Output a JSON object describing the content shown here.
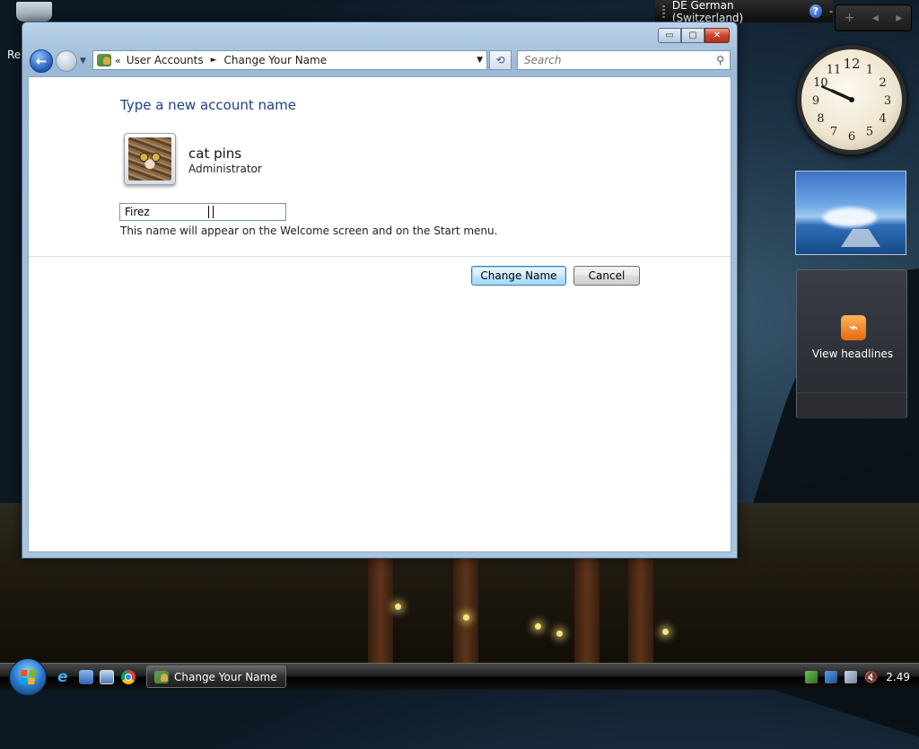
{
  "desktop": {
    "left_stub_text": "Re",
    "language_bar": {
      "language": "DE German (Switzerland)",
      "help": "?",
      "minimize": "-"
    },
    "sidebar_controls": {
      "add": "+",
      "prev": "◂",
      "next": "▸"
    },
    "clock": {
      "numbers": [
        "12",
        "1",
        "2",
        "3",
        "4",
        "5",
        "6",
        "7",
        "8",
        "9",
        "10",
        "11"
      ],
      "hour": 9,
      "minute": 49
    },
    "feeds_gadget": {
      "label": "View headlines"
    }
  },
  "window": {
    "caption_buttons": {
      "minimize": "▭",
      "maximize": "▢",
      "close": "✕"
    },
    "nav": {
      "back": "←",
      "dropdown": "▼"
    },
    "address": {
      "overflow": "«",
      "crumbs": [
        "User Accounts",
        "Change Your Name"
      ],
      "separator": "►",
      "dropdown": "▼"
    },
    "refresh": "⟲",
    "search": {
      "placeholder": "Search",
      "icon": "⚲"
    },
    "page": {
      "heading": "Type a new account name",
      "user_name": "cat pins",
      "user_role": "Administrator",
      "name_value": "Firez",
      "hint": "This name will appear on the Welcome screen and on the Start menu.",
      "primary_button": "Change Name",
      "cancel_button": "Cancel"
    }
  },
  "taskbar": {
    "task_button_label": "Change Your Name",
    "ie_glyph": "e",
    "tray": {
      "volume": "🔇",
      "time": "2.49"
    }
  }
}
